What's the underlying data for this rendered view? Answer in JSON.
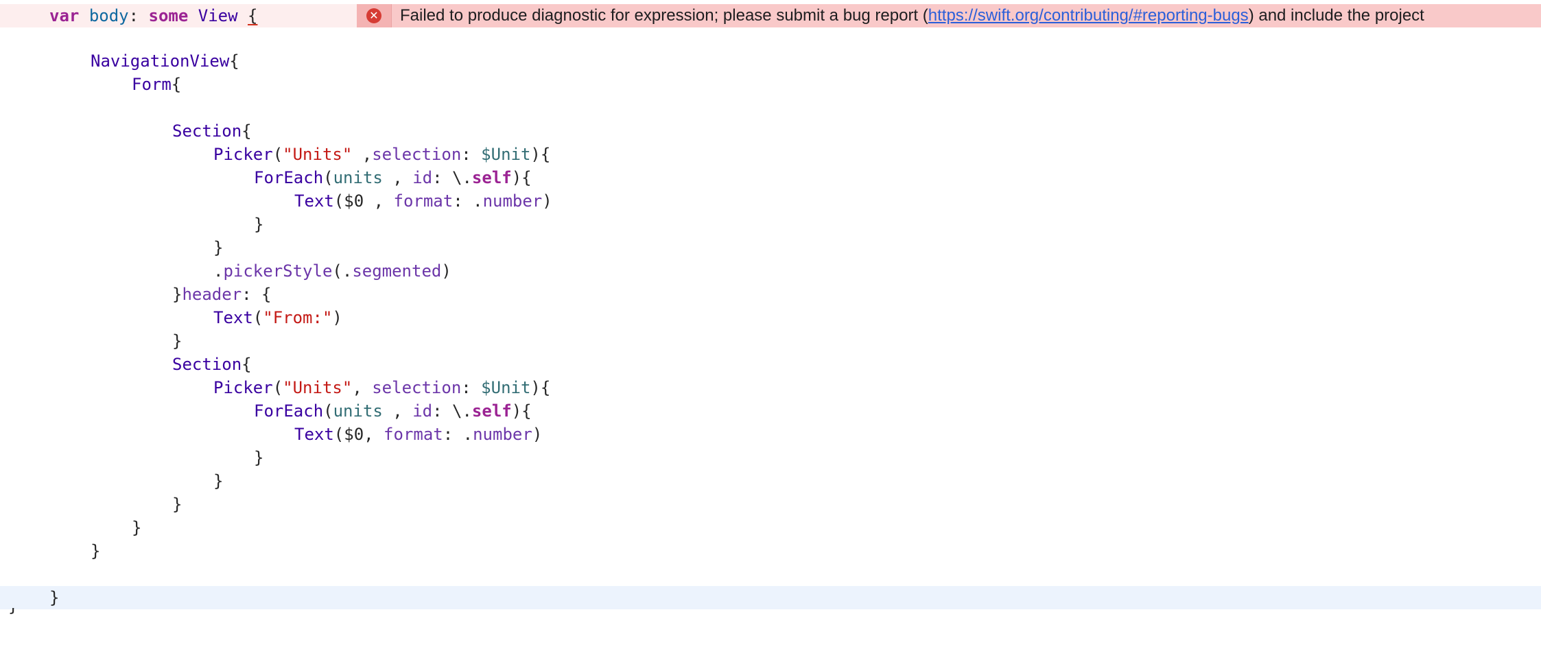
{
  "error": {
    "message_before": "Failed to produce diagnostic for expression; please submit a bug report (",
    "link_text": "https://swift.org/contributing/#reporting-bugs",
    "message_after": ") and include the project"
  },
  "code": {
    "l1": {
      "kw1": "var",
      "name": "body",
      "colon": ": ",
      "kw2": "some",
      "type": "View",
      "brace": "{"
    },
    "l3": {
      "type": "NavigationView",
      "rest": "{"
    },
    "l4": {
      "type": "Form",
      "rest": "{"
    },
    "l6": {
      "type": "Section",
      "rest": "{"
    },
    "l7": {
      "type": "Picker",
      "p1": "(",
      "str": "\"Units\"",
      "p2": " ,",
      "attr": "selection",
      "p3": ": ",
      "var": "$Unit",
      "p4": "){"
    },
    "l8": {
      "type": "ForEach",
      "p1": "(",
      "var": "units",
      "p2": " , ",
      "attr": "id",
      "p3": ": \\.",
      "kw": "self",
      "p4": "){"
    },
    "l9": {
      "type": "Text",
      "p1": "($0 , ",
      "attr": "format",
      "p2": ": .",
      "attr2": "number",
      "p3": ")"
    },
    "l10": "}",
    "l11": "}",
    "l12": {
      "p1": ".",
      "attr": "pickerStyle",
      "p2": "(.",
      "attr2": "segmented",
      "p3": ")"
    },
    "l13": {
      "p1": "}",
      "attr": "header",
      "p2": ": {"
    },
    "l14": {
      "type": "Text",
      "p1": "(",
      "str": "\"From:\"",
      "p2": ")"
    },
    "l15": "}",
    "l16": {
      "type": "Section",
      "rest": "{"
    },
    "l17": {
      "type": "Picker",
      "p1": "(",
      "str": "\"Units\"",
      "p2": ", ",
      "attr": "selection",
      "p3": ": ",
      "var": "$Unit",
      "p4": "){"
    },
    "l18": {
      "type": "ForEach",
      "p1": "(",
      "var": "units",
      "p2": " , ",
      "attr": "id",
      "p3": ": \\.",
      "kw": "self",
      "p4": "){"
    },
    "l19": {
      "type": "Text",
      "p1": "($0, ",
      "attr": "format",
      "p2": ": .",
      "attr2": "number",
      "p3": ")"
    },
    "l20": "}",
    "l21": "}",
    "l22": "}",
    "l23": "}",
    "l24": "}",
    "l26": "}",
    "l27": "}"
  }
}
